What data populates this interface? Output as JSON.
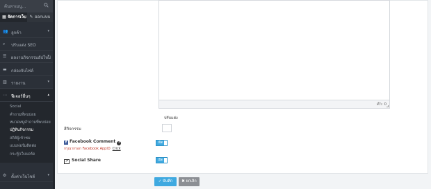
{
  "sidebar": {
    "search_placeholder": "ค้นหาเมนู...",
    "tabs": [
      {
        "label": "จัดการเว็บ",
        "icon": "grid-icon"
      },
      {
        "label": "ออกแบบ",
        "icon": "brush-icon"
      }
    ],
    "menu": [
      {
        "label": "ลูกค้า",
        "icon": "users-icon"
      },
      {
        "label": "ปรับแต่ง SEO",
        "icon": "search-icon"
      },
      {
        "label": "ผลงานกิจกรรมอัปใหม่",
        "icon": "list-icon"
      },
      {
        "label": "กล่องจับไฟล์",
        "icon": "folder-icon"
      },
      {
        "label": "รายงาน",
        "icon": "chart-icon"
      },
      {
        "label": "ฟีเจอร์อื่นๆ",
        "icon": "dots-icon"
      }
    ],
    "submenu": [
      "Social",
      "คำถามที่พบบ่อย",
      "หมวดหมู่คำถามที่พบบ่อย",
      "ปฏิทินกิจกรรม",
      "สถิติผู้เข้าชม",
      "แบบฟอร์มติดต่อ",
      "กระทู้/เว็บบอร์ด"
    ],
    "bottom_menu": {
      "label": "ตั้งค่าเว็บไซต์",
      "icon": "gear-icon"
    }
  },
  "editor": {
    "counter": "คำ: 0"
  },
  "form": {
    "show_label": "ปรับแต่ง",
    "activity_label": "สีกิจกรรม",
    "facebook_comment_label": "Facebook Comment",
    "facebook_note": "กรุณากรอก Facebook AppID",
    "facebook_link": "Click",
    "social_share_label": "Social Share",
    "toggle_text": "เปิด"
  },
  "actions": {
    "save": "✓ บันทึก",
    "cancel": "✖ ยกเลิก"
  },
  "colors": {
    "sidebar_bg": "#2b3038",
    "accent": "#3fa9e0",
    "cancel": "#8c8f94"
  }
}
